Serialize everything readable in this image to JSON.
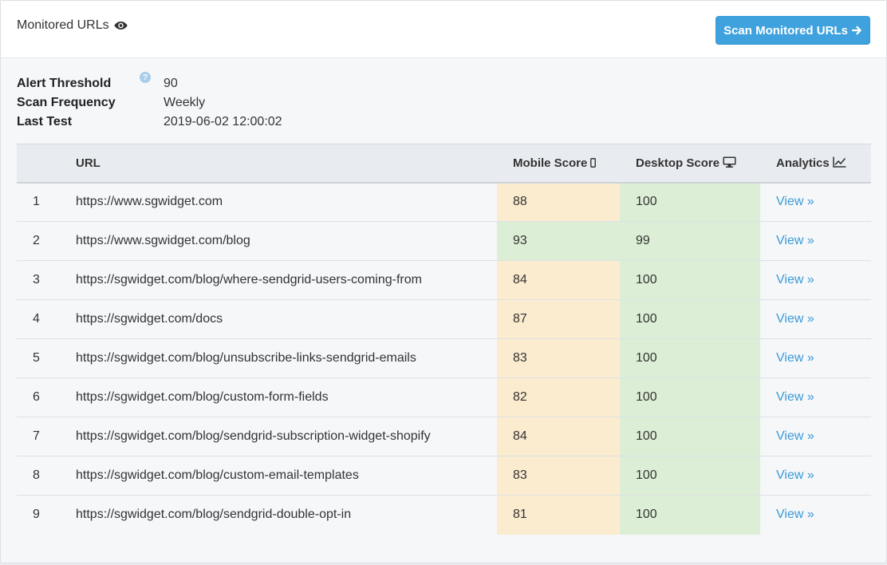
{
  "header": {
    "title": "Monitored URLs",
    "title_icon": "eye-icon",
    "scan_button_label": "Scan Monitored URLs",
    "scan_button_icon": "arrow-right-icon"
  },
  "settings": {
    "alert_threshold": {
      "label": "Alert Threshold",
      "value": "90",
      "help_icon": "question-circle-icon",
      "help_glyph": "?"
    },
    "scan_frequency": {
      "label": "Scan Frequency",
      "value": "Weekly"
    },
    "last_test": {
      "label": "Last Test",
      "value": "2019-06-02 12:00:02"
    }
  },
  "table": {
    "headers": {
      "num": "",
      "url": "URL",
      "mobile": "Mobile Score",
      "mobile_icon": "mobile-icon",
      "desktop": "Desktop Score",
      "desktop_icon": "desktop-icon",
      "analytics": "Analytics",
      "analytics_icon": "line-chart-icon"
    },
    "view_label": "View »",
    "colors": {
      "orange": "#fbeccf",
      "green": "#dcefd6",
      "link": "#3a9ad9"
    },
    "rows": [
      {
        "num": "1",
        "url": "https://www.sgwidget.com",
        "mobile": "88",
        "desktop": "100",
        "mobile_status": "orange",
        "desktop_status": "green"
      },
      {
        "num": "2",
        "url": "https://www.sgwidget.com/blog",
        "mobile": "93",
        "desktop": "99",
        "mobile_status": "green",
        "desktop_status": "green"
      },
      {
        "num": "3",
        "url": "https://sgwidget.com/blog/where-sendgrid-users-coming-from",
        "mobile": "84",
        "desktop": "100",
        "mobile_status": "orange",
        "desktop_status": "green"
      },
      {
        "num": "4",
        "url": "https://sgwidget.com/docs",
        "mobile": "87",
        "desktop": "100",
        "mobile_status": "orange",
        "desktop_status": "green"
      },
      {
        "num": "5",
        "url": "https://sgwidget.com/blog/unsubscribe-links-sendgrid-emails",
        "mobile": "83",
        "desktop": "100",
        "mobile_status": "orange",
        "desktop_status": "green"
      },
      {
        "num": "6",
        "url": "https://sgwidget.com/blog/custom-form-fields",
        "mobile": "82",
        "desktop": "100",
        "mobile_status": "orange",
        "desktop_status": "green"
      },
      {
        "num": "7",
        "url": "https://sgwidget.com/blog/sendgrid-subscription-widget-shopify",
        "mobile": "84",
        "desktop": "100",
        "mobile_status": "orange",
        "desktop_status": "green"
      },
      {
        "num": "8",
        "url": "https://sgwidget.com/blog/custom-email-templates",
        "mobile": "83",
        "desktop": "100",
        "mobile_status": "orange",
        "desktop_status": "green"
      },
      {
        "num": "9",
        "url": "https://sgwidget.com/blog/sendgrid-double-opt-in",
        "mobile": "81",
        "desktop": "100",
        "mobile_status": "orange",
        "desktop_status": "green"
      }
    ]
  }
}
